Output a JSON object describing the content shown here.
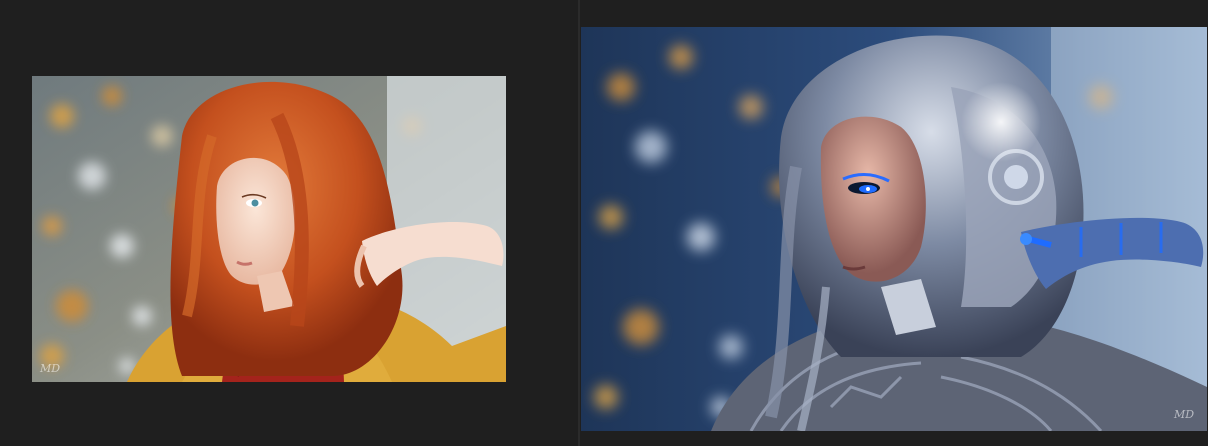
{
  "images": [
    {
      "label": "original-portrait",
      "description_name": "woman-red-hair-yellow-sweater",
      "watermark": "MD"
    },
    {
      "label": "ai-transformed-portrait",
      "description_name": "woman-cyborg-android",
      "watermark": "MD"
    }
  ],
  "colors": {
    "background": "#1f1f1f",
    "hair": "#c4501e",
    "sweater": "#d9a232",
    "scarf": "#a4231c",
    "cyborg_glow": "#1f6cff",
    "bokeh_blue": "#2c4c7c"
  }
}
